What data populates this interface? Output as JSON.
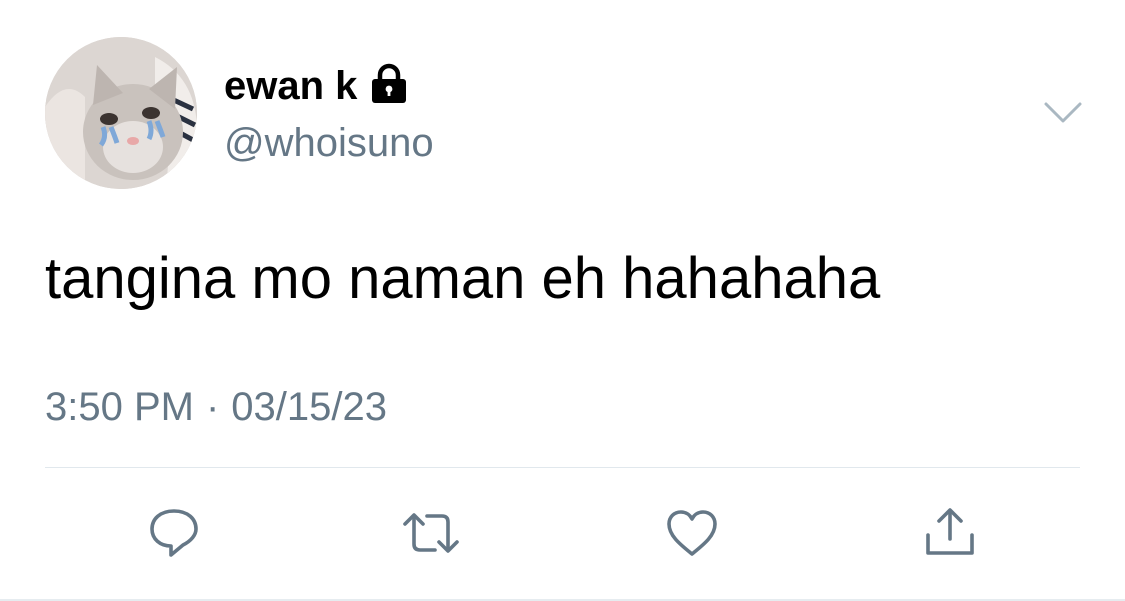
{
  "user": {
    "display_name": "ewan k",
    "handle": "@whoisuno",
    "protected": true,
    "avatar_icon": "crying-cat-avatar"
  },
  "tweet": {
    "text": "tangina mo naman eh hahahaha",
    "time": "3:50 PM",
    "separator": "·",
    "date": "03/15/23"
  },
  "actions": [
    {
      "name": "reply",
      "icon": "speech-bubble-icon"
    },
    {
      "name": "retweet",
      "icon": "retweet-arrows-icon"
    },
    {
      "name": "like",
      "icon": "heart-icon"
    },
    {
      "name": "share",
      "icon": "share-upload-icon"
    }
  ],
  "colors": {
    "text": "#000000",
    "secondary": "#657786",
    "divider": "#e1e8ed"
  }
}
